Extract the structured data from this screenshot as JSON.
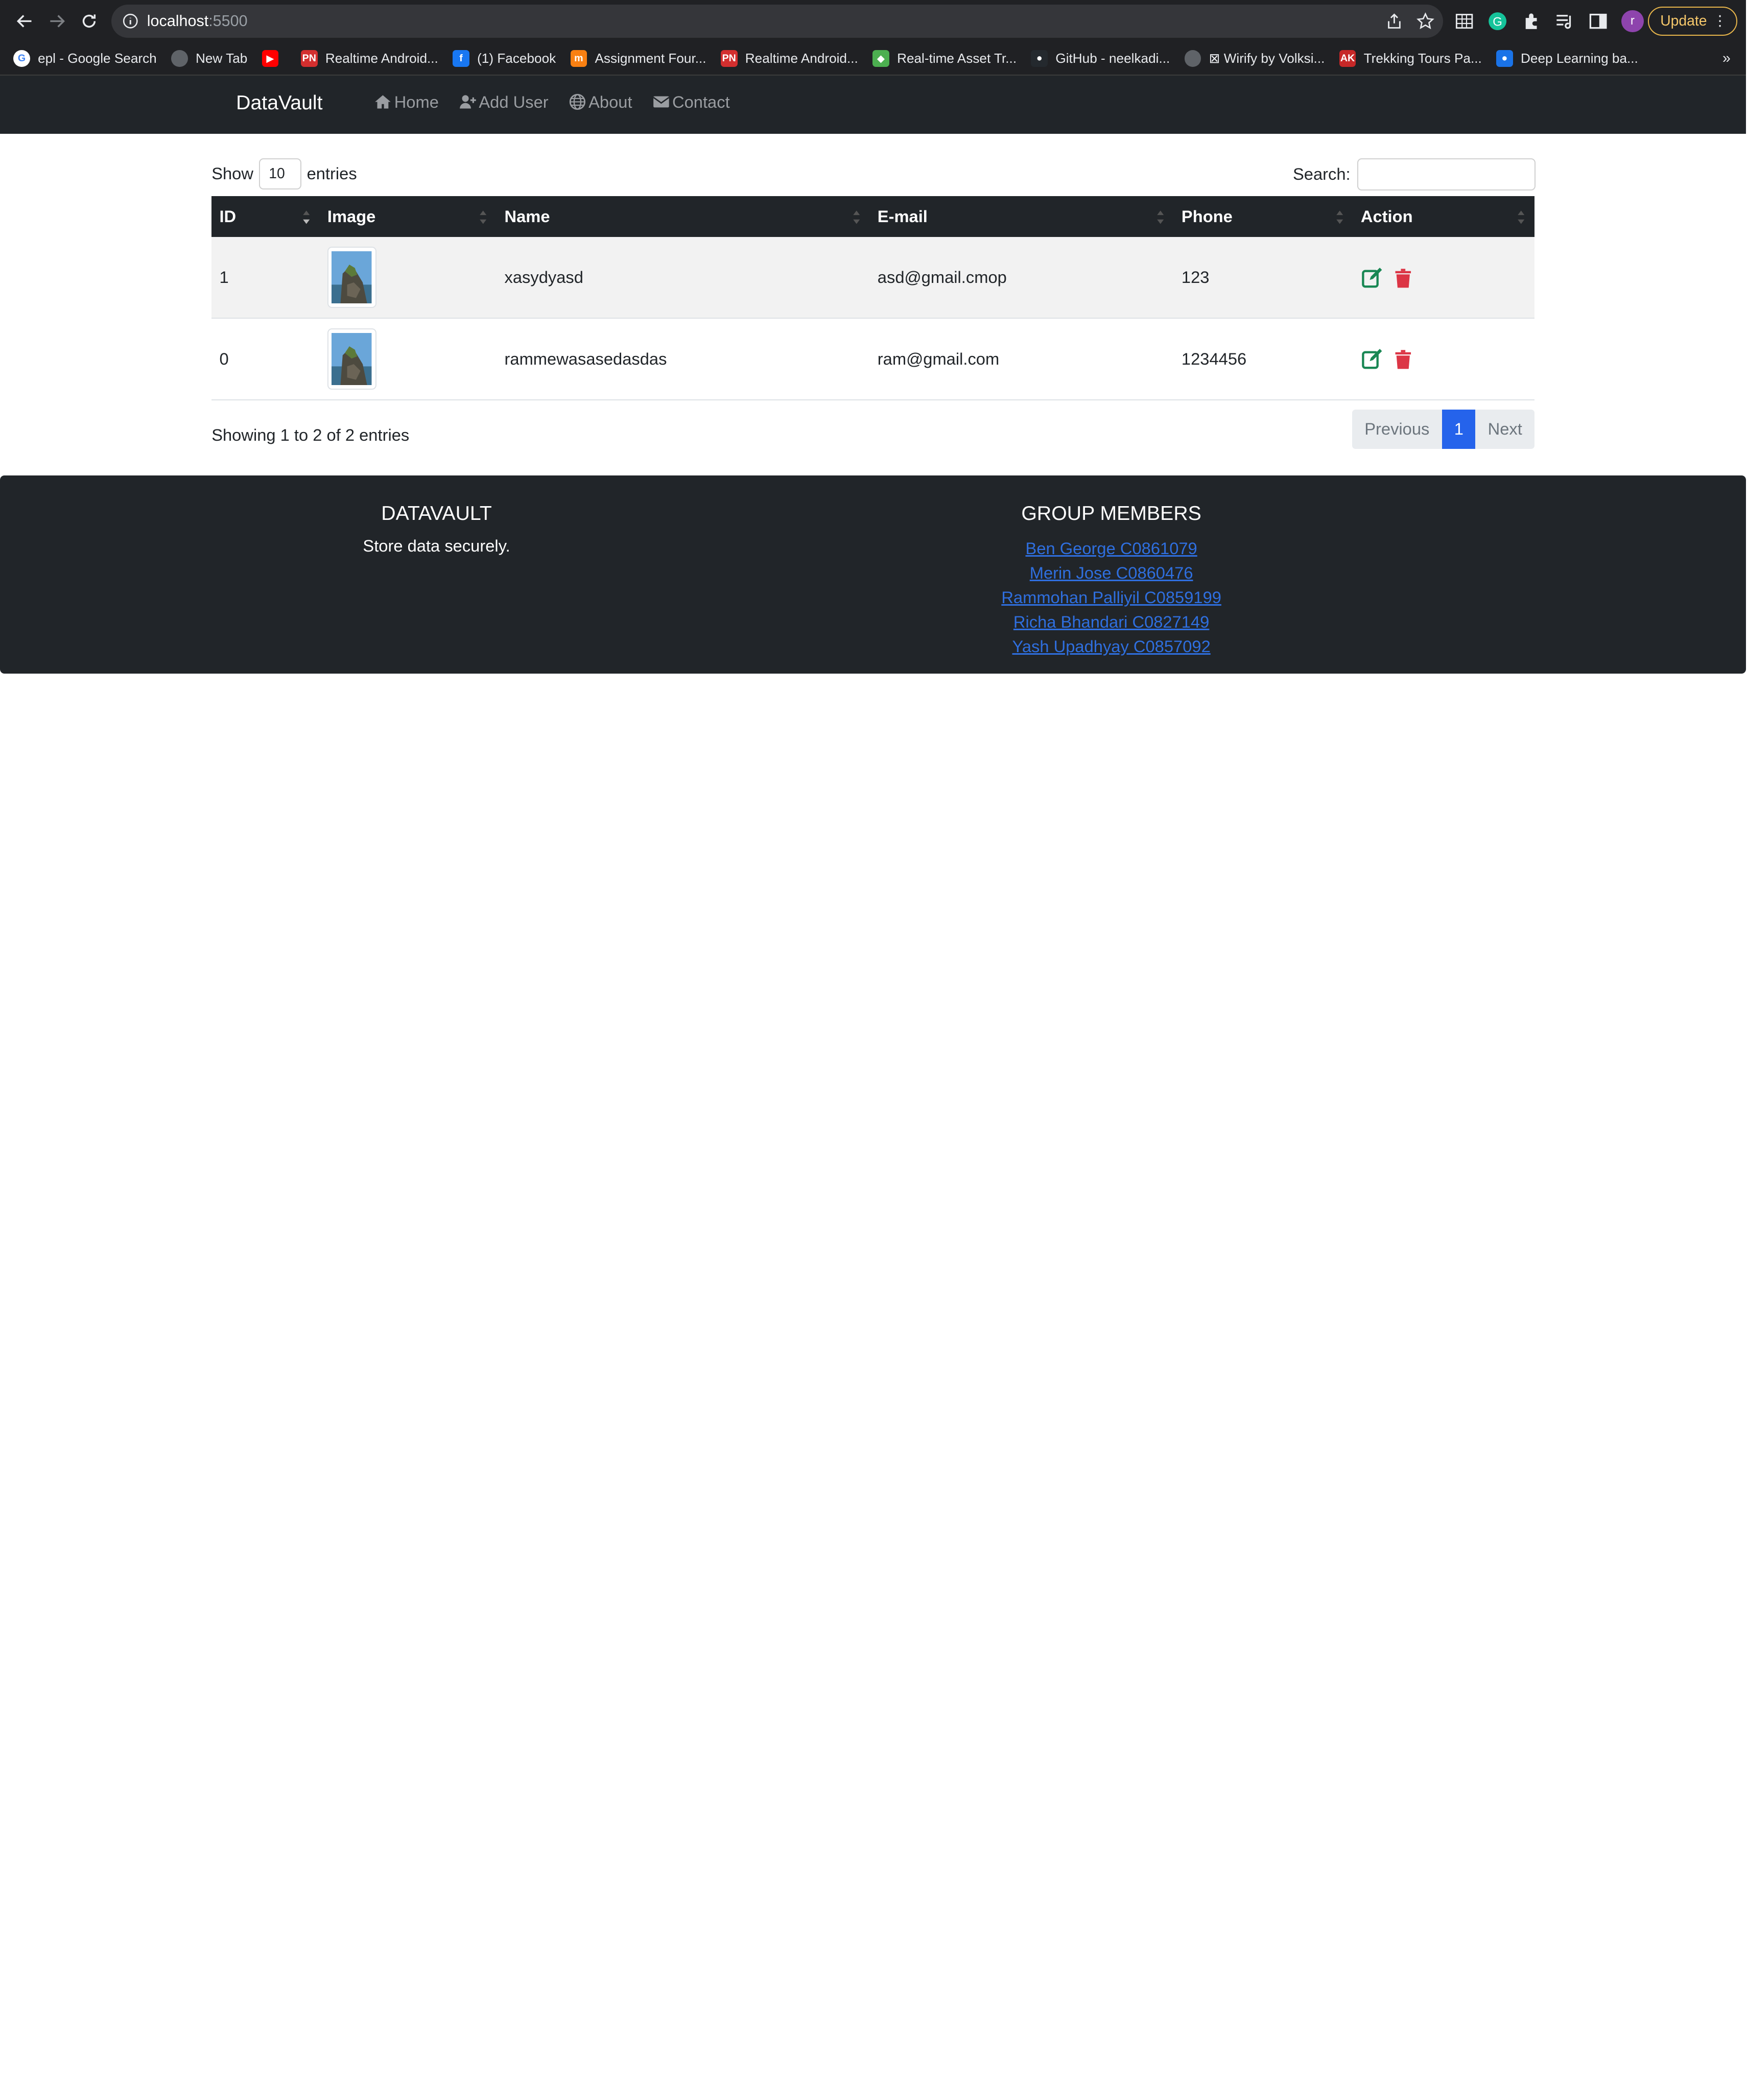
{
  "browser": {
    "url_host": "localhost",
    "url_port": ":5500",
    "update_label": "Update",
    "avatar_letter": "r",
    "bookmarks": [
      {
        "label": "epl - Google Search",
        "icon": "google-icon",
        "color": "#ffffff",
        "glyph": "G"
      },
      {
        "label": "New Tab",
        "icon": "globe-icon",
        "color": "#5f6368",
        "glyph": ""
      },
      {
        "label": "",
        "icon": "youtube-icon",
        "color": "#ff0000",
        "glyph": "▶"
      },
      {
        "label": "Realtime Android...",
        "icon": "pn-icon",
        "color": "#d32f2f",
        "glyph": "PN"
      },
      {
        "label": "(1) Facebook",
        "icon": "facebook-icon",
        "color": "#1877f2",
        "glyph": "f"
      },
      {
        "label": "Assignment Four...",
        "icon": "moodle-icon",
        "color": "#f98012",
        "glyph": "m"
      },
      {
        "label": "Realtime Android...",
        "icon": "pn-icon",
        "color": "#d32f2f",
        "glyph": "PN"
      },
      {
        "label": "Real-time Asset Tr...",
        "icon": "asset-icon",
        "color": "#4caf50",
        "glyph": "◆"
      },
      {
        "label": "GitHub - neelkadi...",
        "icon": "github-icon",
        "color": "#24292e",
        "glyph": "●"
      },
      {
        "label": "⊠ Wirify by Volksi...",
        "icon": "globe-icon",
        "color": "#5f6368",
        "glyph": ""
      },
      {
        "label": "Trekking Tours Pa...",
        "icon": "ak-icon",
        "color": "#c62828",
        "glyph": "AK"
      },
      {
        "label": "Deep Learning ba...",
        "icon": "dl-icon",
        "color": "#1a73e8",
        "glyph": "●"
      }
    ],
    "more": "»"
  },
  "nav": {
    "brand": "DataVault",
    "links": [
      {
        "label": "Home",
        "icon": "home-icon"
      },
      {
        "label": "Add User",
        "icon": "add-user-icon"
      },
      {
        "label": "About",
        "icon": "globe-icon"
      },
      {
        "label": "Contact",
        "icon": "envelope-icon"
      }
    ]
  },
  "table_controls": {
    "show_label": "Show",
    "entries_value": "10",
    "entries_label": "entries",
    "search_label": "Search:",
    "search_value": ""
  },
  "table": {
    "columns": [
      "ID",
      "Image",
      "Name",
      "E-mail",
      "Phone",
      "Action"
    ],
    "rows": [
      {
        "id": "1",
        "name": "xasydyasd",
        "email": "asd@gmail.cmop",
        "phone": "123"
      },
      {
        "id": "0",
        "name": "rammewasasedasdas",
        "email": "ram@gmail.com",
        "phone": "1234456"
      }
    ]
  },
  "table_footer": {
    "info": "Showing 1 to 2 of 2 entries",
    "prev_label": "Previous",
    "current_page": "1",
    "next_label": "Next"
  },
  "footer": {
    "title": "DATAVAULT",
    "tagline": "Store data securely.",
    "members_title": "GROUP MEMBERS",
    "members": [
      "Ben George C0861079",
      "Merin Jose C0860476",
      "Rammohan Palliyil C0859199",
      "Richa Bhandari C0827149",
      "Yash Upadhyay C0857092"
    ]
  },
  "colors": {
    "navbar": "#212529",
    "edit": "#198754",
    "delete": "#dc3545",
    "active_page": "#2563eb",
    "link": "#2f6fdf"
  }
}
